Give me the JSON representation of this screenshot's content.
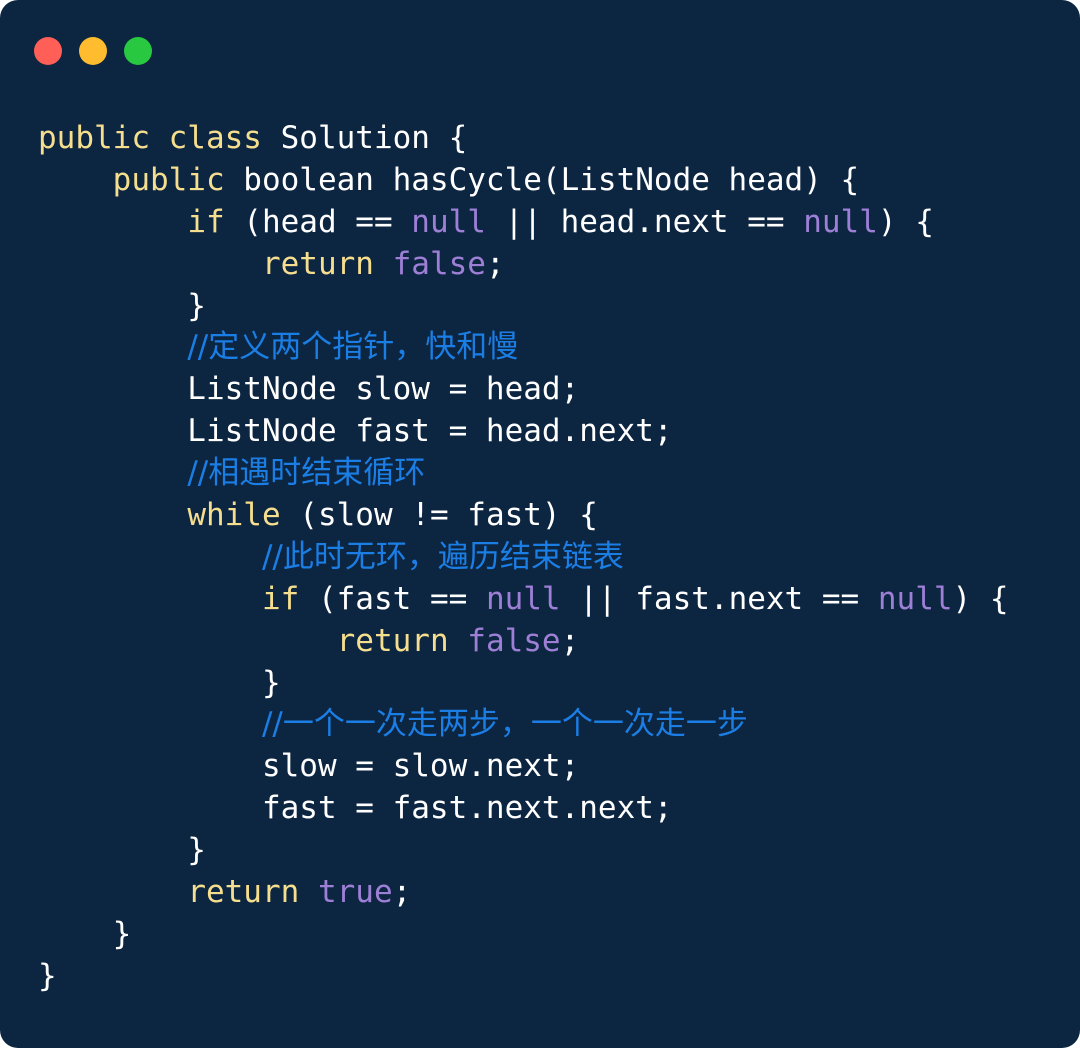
{
  "window": {
    "buttons": {
      "close_color": "#ff5f57",
      "minimize_color": "#febc2e",
      "zoom_color": "#28c840"
    },
    "background": "#0c2541"
  },
  "colors": {
    "keyword": "#f5de8e",
    "literal": "#9d7fd6",
    "comment": "#1b7ee5",
    "plain": "#ffffff"
  },
  "code": {
    "lines": [
      [
        {
          "t": "public class",
          "k": "kw"
        },
        {
          "t": " Solution {",
          "k": "id"
        }
      ],
      [
        {
          "t": "    ",
          "k": "id"
        },
        {
          "t": "public",
          "k": "kw"
        },
        {
          "t": " boolean hasCycle(ListNode head) {",
          "k": "id"
        }
      ],
      [
        {
          "t": "        ",
          "k": "id"
        },
        {
          "t": "if",
          "k": "kw"
        },
        {
          "t": " (head == ",
          "k": "id"
        },
        {
          "t": "null",
          "k": "lit"
        },
        {
          "t": " || head.next == ",
          "k": "id"
        },
        {
          "t": "null",
          "k": "lit"
        },
        {
          "t": ") {",
          "k": "id"
        }
      ],
      [
        {
          "t": "            ",
          "k": "id"
        },
        {
          "t": "return",
          "k": "kw"
        },
        {
          "t": " ",
          "k": "id"
        },
        {
          "t": "false",
          "k": "lit"
        },
        {
          "t": ";",
          "k": "id"
        }
      ],
      [
        {
          "t": "        }",
          "k": "id"
        }
      ],
      [
        {
          "t": "        ",
          "k": "id"
        },
        {
          "t": "//定义两个指针，快和慢",
          "k": "cmt"
        }
      ],
      [
        {
          "t": "        ListNode slow = head;",
          "k": "id"
        }
      ],
      [
        {
          "t": "        ListNode fast = head.next;",
          "k": "id"
        }
      ],
      [
        {
          "t": "        ",
          "k": "id"
        },
        {
          "t": "//相遇时结束循环",
          "k": "cmt"
        }
      ],
      [
        {
          "t": "        ",
          "k": "id"
        },
        {
          "t": "while",
          "k": "kw"
        },
        {
          "t": " (slow != fast) {",
          "k": "id"
        }
      ],
      [
        {
          "t": "            ",
          "k": "id"
        },
        {
          "t": "//此时无环，遍历结束链表",
          "k": "cmt"
        }
      ],
      [
        {
          "t": "            ",
          "k": "id"
        },
        {
          "t": "if",
          "k": "kw"
        },
        {
          "t": " (fast == ",
          "k": "id"
        },
        {
          "t": "null",
          "k": "lit"
        },
        {
          "t": " || fast.next == ",
          "k": "id"
        },
        {
          "t": "null",
          "k": "lit"
        },
        {
          "t": ") {",
          "k": "id"
        }
      ],
      [
        {
          "t": "                ",
          "k": "id"
        },
        {
          "t": "return",
          "k": "kw"
        },
        {
          "t": " ",
          "k": "id"
        },
        {
          "t": "false",
          "k": "lit"
        },
        {
          "t": ";",
          "k": "id"
        }
      ],
      [
        {
          "t": "            }",
          "k": "id"
        }
      ],
      [
        {
          "t": "            ",
          "k": "id"
        },
        {
          "t": "//一个一次走两步，一个一次走一步",
          "k": "cmt"
        }
      ],
      [
        {
          "t": "            slow = slow.next;",
          "k": "id"
        }
      ],
      [
        {
          "t": "            fast = fast.next.next;",
          "k": "id"
        }
      ],
      [
        {
          "t": "        }",
          "k": "id"
        }
      ],
      [
        {
          "t": "        ",
          "k": "id"
        },
        {
          "t": "return",
          "k": "kw"
        },
        {
          "t": " ",
          "k": "id"
        },
        {
          "t": "true",
          "k": "lit"
        },
        {
          "t": ";",
          "k": "id"
        }
      ],
      [
        {
          "t": "    }",
          "k": "id"
        }
      ],
      [
        {
          "t": "}",
          "k": "id"
        }
      ]
    ]
  }
}
